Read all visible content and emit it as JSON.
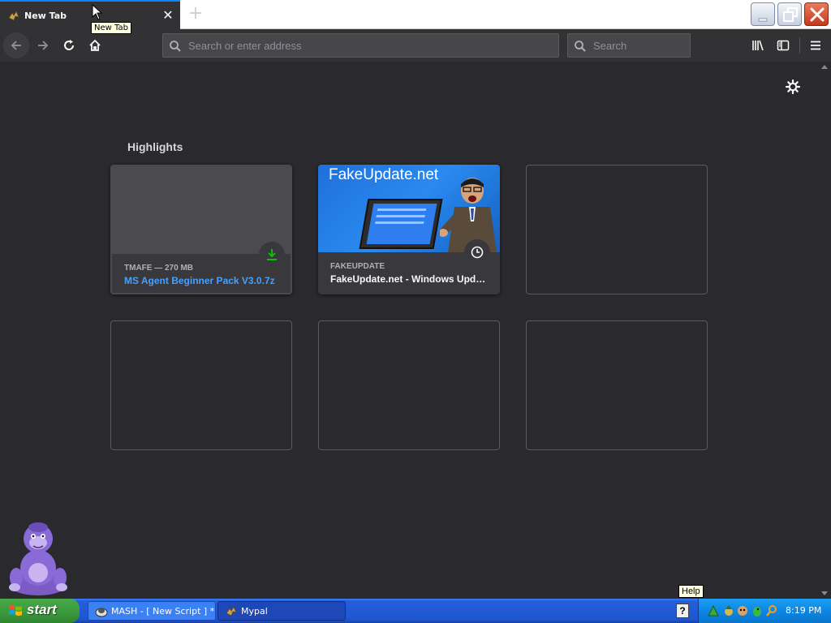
{
  "browser": {
    "tab": {
      "title": "New Tab",
      "tooltip": "New Tab"
    },
    "urlbar": {
      "placeholder": "Search or enter address"
    },
    "searchbar": {
      "placeholder": "Search"
    }
  },
  "newtab": {
    "highlights_title": "Highlights",
    "cards": [
      {
        "meta": "TMAFE — 270 MB",
        "title": "MS Agent Beginner Pack V3.0.7z",
        "badge": "download-icon"
      },
      {
        "meta": "FAKEUPDATE",
        "title": "FakeUpdate.net - Windows Update",
        "badge": "clock-icon",
        "thumb_text": "FakeUpdate.net"
      }
    ]
  },
  "taskbar": {
    "start_label": "start",
    "tasks": [
      {
        "label": "MASH - [ New Script ] *"
      },
      {
        "label": "Mypal"
      }
    ],
    "help_tooltip": "Help",
    "help_button": "?",
    "clock": "8:19 PM"
  },
  "colors": {
    "content_bg": "#2a2a2e",
    "toolbar_bg": "#323234",
    "link_blue": "#45a1ff",
    "accent": "#0a84ff",
    "download_green": "#12bc00"
  }
}
